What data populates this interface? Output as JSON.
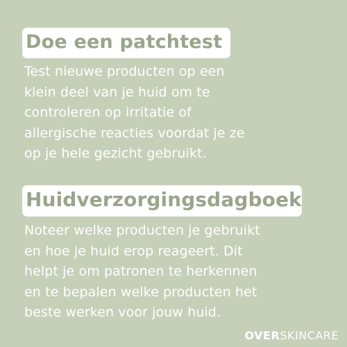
{
  "sections": [
    {
      "heading": "Doe een patchtest",
      "body": "Test nieuwe producten op een\nklein deel van je huid om te\ncontroleren op irritatie of\nallergische reacties voordat je ze\nop je hele gezicht gebruikt."
    },
    {
      "heading": "Huidverzorgingsdagboek",
      "body": "Noteer welke producten je gebruikt\nen hoe je huid erop reageert. Dit\nhelpt je om patronen te herkennen\nen te bepalen welke producten het\nbeste werken voor jouw huid."
    }
  ],
  "brand": {
    "part1": "OVER",
    "part2": "SKINCARE"
  },
  "colors": {
    "background": "#c6d0b8",
    "heading_text": "#9aa58c",
    "heading_box": "#ffffff",
    "body_text": "#ffffff"
  }
}
